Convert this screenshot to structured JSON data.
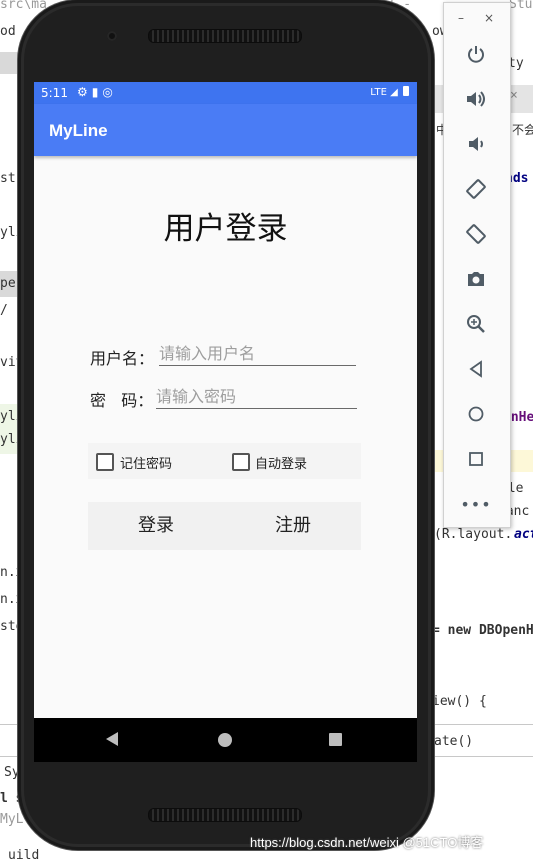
{
  "status_bar": {
    "time": "5:11",
    "network": "LTE"
  },
  "app_bar": {
    "title": "MyLine"
  },
  "login": {
    "title": "用户登录",
    "username_label": "用户名：",
    "username_placeholder": "请输入用户名",
    "password_label": "密   码：",
    "password_placeholder": "请输入密码",
    "remember_label": "记住密码",
    "autologin_label": "自动登录",
    "login_button": "登录",
    "register_button": "注册"
  },
  "emulator_toolbar": {
    "minimize": "–",
    "close": "×",
    "buttons": [
      "power-icon",
      "volume-up-icon",
      "volume-down-icon",
      "rotate-left-icon",
      "rotate-right-icon",
      "camera-icon",
      "zoom-icon",
      "back-icon",
      "home-icon",
      "overview-icon",
      "more-icon"
    ]
  },
  "ide_background": {
    "top_path": "src\\ma",
    "top_path_right": "pp] - ",
    "top_right": "Stu",
    "line_od": "od",
    "line_ow": "ow",
    "line_ty": "ty",
    "line_st": "st.x",
    "line_ds": "nds",
    "line_yli1": "yli",
    "line_per": "per",
    "line_slash": "/",
    "line_vit": "vit",
    "line_yli2": "yli",
    "line_yli3": "yli",
    "line_enhe": "enHe",
    "line_dle": "dle",
    "line_tanc": "tanc",
    "line_layout": "(R.layout.",
    "line_layout_act": "act",
    "line_nx": "n.x",
    "line_nxr": "n.xr",
    "line_ste": "ste",
    "line_new": "= new DBOpenH",
    "line_view": "iew() {",
    "line_sy": "Sy",
    "line_ate": "ate()",
    "line_su": "l su",
    "line_my": "MyL",
    "line_uild": "uild",
    "line_cn": "中 ",
    "line_cn2": "不会",
    "watermark": "https://blog.csdn.net/weixi  @51CTO博客"
  }
}
